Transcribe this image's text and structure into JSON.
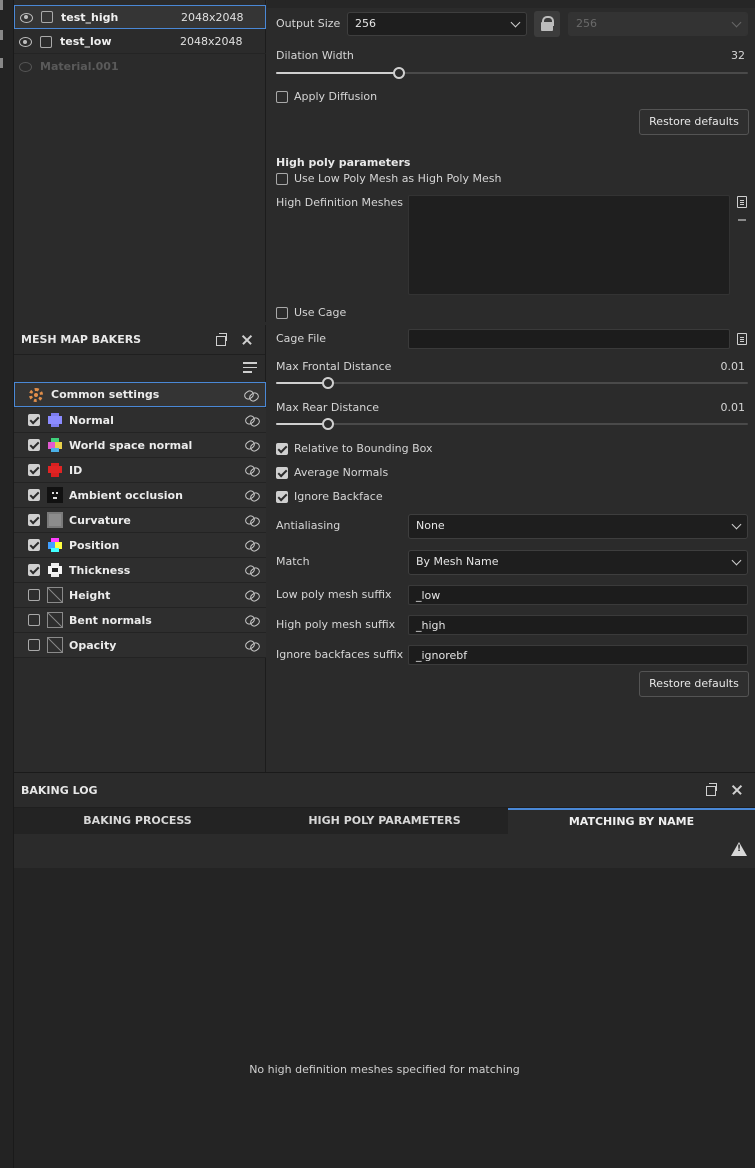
{
  "layers": [
    {
      "name": "test_high",
      "resolution": "2048x2048",
      "checked": false,
      "selected": true,
      "visible": true
    },
    {
      "name": "test_low",
      "resolution": "2048x2048",
      "checked": false,
      "selected": false,
      "visible": true
    },
    {
      "name": "Material.001",
      "resolution": "",
      "checked": false,
      "selected": false,
      "visible": false
    }
  ],
  "bakers_panel": {
    "title": "MESH MAP BAKERS",
    "common_label": "Common settings",
    "items": [
      {
        "label": "Normal",
        "checked": true,
        "thumb": "normal-map-thumbnail"
      },
      {
        "label": "World space normal",
        "checked": true,
        "thumb": "world-normal-thumbnail"
      },
      {
        "label": "ID",
        "checked": true,
        "thumb": "id-map-thumbnail"
      },
      {
        "label": "Ambient occlusion",
        "checked": true,
        "thumb": "ao-thumbnail"
      },
      {
        "label": "Curvature",
        "checked": true,
        "thumb": "curvature-thumbnail"
      },
      {
        "label": "Position",
        "checked": true,
        "thumb": "position-thumbnail"
      },
      {
        "label": "Thickness",
        "checked": true,
        "thumb": "thickness-thumbnail"
      },
      {
        "label": "Height",
        "checked": false,
        "thumb": "empty-thumbnail"
      },
      {
        "label": "Bent normals",
        "checked": false,
        "thumb": "empty-thumbnail"
      },
      {
        "label": "Opacity",
        "checked": false,
        "thumb": "empty-thumbnail"
      }
    ]
  },
  "settings": {
    "output_size_label": "Output Size",
    "output_size_value": "256",
    "output_size_locked_value": "256",
    "dilation_label": "Dilation Width",
    "dilation_value": "32",
    "dilation_fraction": 0.26,
    "apply_diffusion_label": "Apply Diffusion",
    "restore_defaults_1": "Restore defaults",
    "high_poly_title": "High poly parameters",
    "use_low_poly_label": "Use Low Poly Mesh as High Poly Mesh",
    "hd_meshes_label": "High Definition Meshes",
    "use_cage_label": "Use Cage",
    "cage_file_label": "Cage File",
    "cage_file_value": "",
    "max_frontal_label": "Max Frontal Distance",
    "max_frontal_value": "0.01",
    "max_frontal_fraction": 0.11,
    "max_rear_label": "Max Rear Distance",
    "max_rear_value": "0.01",
    "max_rear_fraction": 0.11,
    "relative_bbox_label": "Relative to Bounding Box",
    "average_normals_label": "Average Normals",
    "ignore_backface_label": "Ignore Backface",
    "antialiasing_label": "Antialiasing",
    "antialiasing_value": "None",
    "match_label": "Match",
    "match_value": "By Mesh Name",
    "low_suffix_label": "Low poly mesh suffix",
    "low_suffix_value": "_low",
    "high_suffix_label": "High poly mesh suffix",
    "high_suffix_value": "_high",
    "ignore_suffix_label": "Ignore backfaces suffix",
    "ignore_suffix_value": "_ignorebf",
    "restore_defaults_2": "Restore defaults"
  },
  "baking_log": {
    "title": "BAKING LOG",
    "tabs": [
      "BAKING PROCESS",
      "HIGH POLY PARAMETERS",
      "MATCHING BY NAME"
    ],
    "active_tab": 2,
    "empty_message": "No high definition meshes specified for matching"
  },
  "colors": {
    "accent": "#4a88d6",
    "gear": "#e08e4a",
    "panel_bg": "#2b2b2b"
  }
}
